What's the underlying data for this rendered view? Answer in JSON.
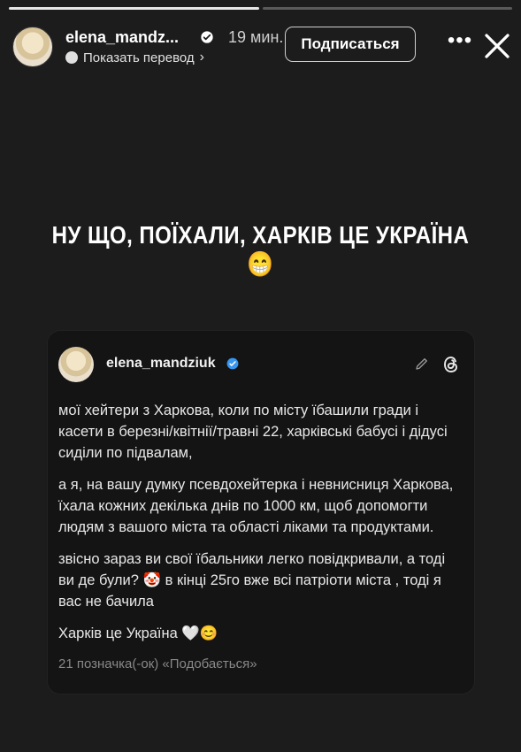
{
  "story": {
    "segments": [
      {
        "state": "done"
      },
      {
        "state": "pending"
      }
    ],
    "username": "elena_mandz...",
    "time": "19 мин.",
    "translate_label": "Показать перевод",
    "follow_label": "Подписаться",
    "more_label": "•••",
    "headline": "НУ ЩО, ПОЇХАЛИ, ХАРКІВ ЦЕ УКРАЇНА 😁"
  },
  "card": {
    "username": "elena_mandziuk",
    "paragraphs": [
      "мої хейтери з Харкова, коли  по місту їбашили гради і касети в березні/квітнії/травні 22, харківські бабусі і дідусі сиділи по підвалам,",
      "а я, на вашу думку псевдохейтерка і невнисниця Харкова, їхала кожних декілька днів по 1000 км, щоб допомогти людям з вашого міста та області ліками та продуктами.",
      "звісно зараз ви свої їбальники легко повідкривали, а тоді ви де були? 🤡 в кінці 25го вже всі патріоти міста , тоді я вас не бачила",
      "Харків це Україна 🤍😊"
    ],
    "likes": "21 позначка(-ок) «Подобається»"
  },
  "colors": {
    "background": "#1c1c1c",
    "card_background": "#141414",
    "verified": "#3897f0"
  },
  "icons": [
    "verified-badge-icon",
    "globe-icon",
    "chevron-right-icon",
    "more-icon",
    "close-icon",
    "pencil-icon",
    "threads-icon"
  ]
}
